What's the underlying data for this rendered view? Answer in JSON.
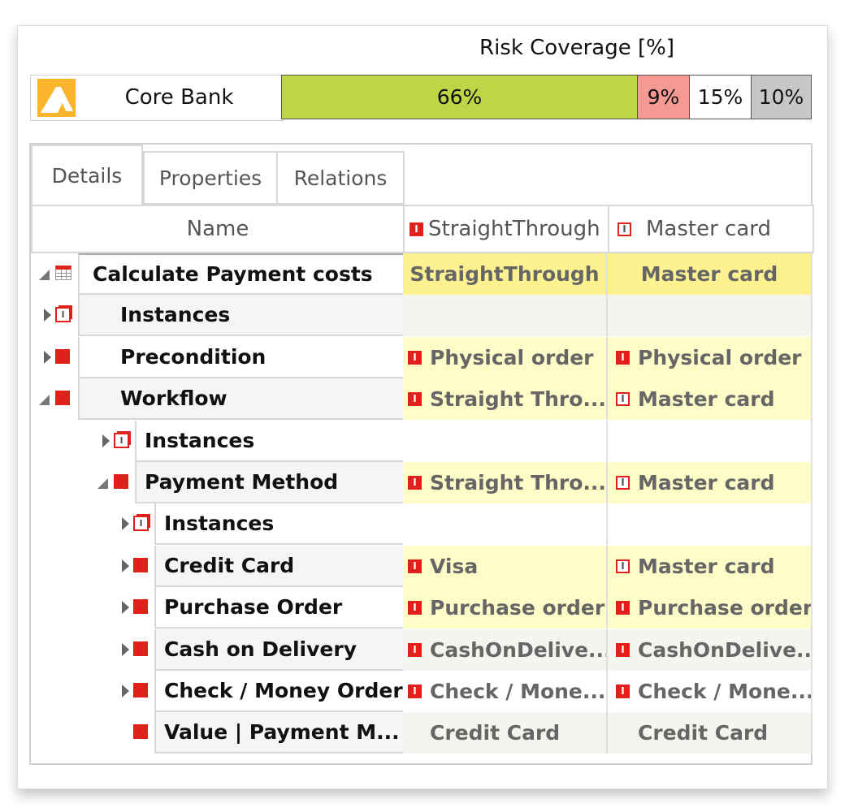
{
  "summary": {
    "title": "Risk Coverage [%]",
    "name": "Core Bank",
    "logo_icon": "mountain-logo-icon",
    "segments": [
      {
        "label": "66%",
        "value": 66,
        "color": "#bfd447"
      },
      {
        "label": "9%",
        "value": 9,
        "color": "#f59a92"
      },
      {
        "label": "15%",
        "value": 15,
        "color": "#ffffff"
      },
      {
        "label": "10%",
        "value": 10,
        "color": "#c7c7c7"
      }
    ]
  },
  "tabs": [
    {
      "label": "Details",
      "active": true
    },
    {
      "label": "Properties",
      "active": false
    },
    {
      "label": "Relations",
      "active": false
    }
  ],
  "columns": {
    "name": "Name",
    "col1": {
      "label": "StraightThrough",
      "icon": "solid"
    },
    "col2": {
      "label": "Master card",
      "icon": "outline"
    }
  },
  "rows": [
    {
      "name": "Calculate Payment costs",
      "level": 0,
      "toggle": "open",
      "icon": "table",
      "bg": "#fff",
      "col1": [
        {
          "text": "StraightThrough",
          "icon": null
        }
      ],
      "col2": [
        {
          "text": "Master card",
          "icon": null
        }
      ],
      "valbg": "#fdf28f",
      "center": true
    },
    {
      "name": "Instances",
      "level": 1,
      "toggle": "closed",
      "icon": "instance",
      "bg": "#f5f5f5",
      "col1": [],
      "col2": [],
      "valbg": "#f5f5f0"
    },
    {
      "name": "Precondition",
      "level": 1,
      "toggle": "closed",
      "icon": "square",
      "bg": "#fff",
      "col1": [
        {
          "text": "Physical order",
          "icon": "solid"
        }
      ],
      "col2": [
        {
          "text": "Physical order",
          "icon": "solid"
        }
      ],
      "valbg": "#fefdc8"
    },
    {
      "name": "Workflow",
      "level": 1,
      "toggle": "open",
      "icon": "square",
      "bg": "#f5f5f5",
      "col1": [
        {
          "text": "Straight Thro...",
          "icon": "solid"
        }
      ],
      "col2": [
        {
          "text": "Master card",
          "icon": "outline"
        }
      ],
      "valbg": "#fefdc8"
    },
    {
      "name": "Instances",
      "level": 2,
      "toggle": "closed",
      "icon": "instance",
      "bg": "#fff",
      "col1": [],
      "col2": [],
      "valbg": "#ffffff"
    },
    {
      "name": "Payment Method",
      "level": 2,
      "toggle": "open",
      "icon": "square",
      "bg": "#f5f5f5",
      "col1": [
        {
          "text": "Straight Thro...",
          "icon": "solid"
        }
      ],
      "col2": [
        {
          "text": "Master card",
          "icon": "outline"
        }
      ],
      "valbg": "#fefdc8"
    },
    {
      "name": "Instances",
      "level": 3,
      "toggle": "closed",
      "icon": "instance",
      "bg": "#fff",
      "col1": [],
      "col2": [],
      "valbg": "#ffffff"
    },
    {
      "name": "Credit Card",
      "level": 3,
      "toggle": "closed",
      "icon": "square",
      "bg": "#f5f5f5",
      "col1": [
        {
          "text": "Visa",
          "icon": "solid"
        }
      ],
      "col2": [
        {
          "text": "Master card",
          "icon": "outline"
        }
      ],
      "valbg": "#fefdc8"
    },
    {
      "name": "Purchase Order",
      "level": 3,
      "toggle": "closed",
      "icon": "square",
      "bg": "#fff",
      "col1": [
        {
          "text": "Purchase order",
          "icon": "solid"
        }
      ],
      "col2": [
        {
          "text": "Purchase order",
          "icon": "solid"
        }
      ],
      "valbg": "#fefdc8"
    },
    {
      "name": "Cash on Delivery",
      "level": 3,
      "toggle": "closed",
      "icon": "square",
      "bg": "#f5f5f5",
      "col1": [
        {
          "text": "CashOnDelive...",
          "icon": "solid"
        }
      ],
      "col2": [
        {
          "text": "CashOnDelive...",
          "icon": "solid"
        }
      ],
      "valbg": "#f5f5f0"
    },
    {
      "name": "Check / Money Order",
      "level": 3,
      "toggle": "closed",
      "icon": "square",
      "bg": "#fff",
      "col1": [
        {
          "text": "Check / Mone...",
          "icon": "solid"
        }
      ],
      "col2": [
        {
          "text": "Check / Mone...",
          "icon": "solid"
        }
      ],
      "valbg": "#ffffff"
    },
    {
      "name": "Value | Payment M...",
      "level": 3,
      "toggle": null,
      "icon": "square",
      "bg": "#f5f5f5",
      "col1": [
        {
          "text": "Credit Card",
          "icon": "none"
        }
      ],
      "col2": [
        {
          "text": "Credit Card",
          "icon": "none"
        }
      ],
      "valbg": "#f5f5f0"
    }
  ]
}
